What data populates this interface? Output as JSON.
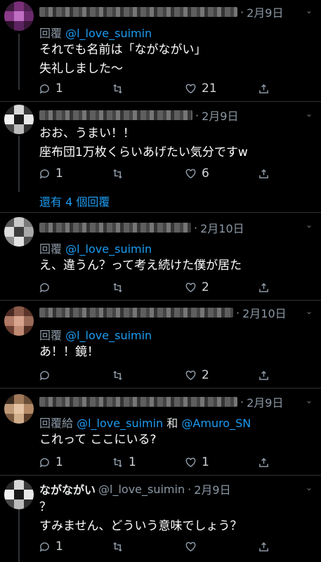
{
  "tweets": [
    {
      "date": "2月9日",
      "reply_label": "回覆",
      "reply_to": "@l_love_suimin",
      "lines": [
        "それでも名前は「ながながい」",
        "失礼しました〜"
      ],
      "reply_count": "1",
      "retweet_count": "",
      "like_count": "21"
    },
    {
      "date": "2月9日",
      "lines": [
        "おお、うまい！！",
        "座布団1万枚くらいあげたい気分ですw"
      ],
      "reply_count": "1",
      "retweet_count": "",
      "like_count": "6",
      "more_replies": "還有 4 個回覆"
    },
    {
      "date": "2月10日",
      "reply_label": "回覆",
      "reply_to": "@l_love_suimin",
      "lines": [
        "え、違うん？って考え続けた僕が居た"
      ],
      "reply_count": "",
      "retweet_count": "",
      "like_count": "2"
    },
    {
      "date": "2月10日",
      "reply_label": "回覆",
      "reply_to": "@l_love_suimin",
      "lines": [
        "あ！！鏡！"
      ],
      "reply_count": "",
      "retweet_count": "",
      "like_count": "2"
    },
    {
      "date": "2月9日",
      "reply_label": "回覆給",
      "reply_to": "@l_love_suimin",
      "reply_and": "和",
      "reply_to_2": "@Amuro_SN",
      "lines": [
        "これって ここにいる?"
      ],
      "reply_count": "1",
      "retweet_count": "1",
      "like_count": "1"
    },
    {
      "display_name": "ながながい",
      "handle": "@l_love_suimin",
      "date": "2月9日",
      "lines": [
        "？",
        "すみません、どういう意味でしょう？"
      ],
      "reply_count": "1",
      "retweet_count": "",
      "like_count": ""
    }
  ],
  "separator": "·",
  "icons": {
    "reply": "reply-icon",
    "retweet": "retweet-icon",
    "like": "heart-icon",
    "share": "share-icon",
    "caret": "chevron-down-icon"
  },
  "colors": {
    "background": "#000000",
    "link": "#1d9bf0",
    "muted": "#8b98a5",
    "text": "#ffffff"
  }
}
